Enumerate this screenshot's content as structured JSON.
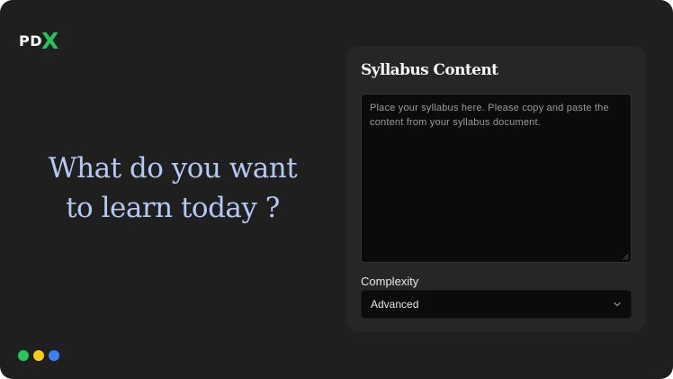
{
  "logo": {
    "prefix": "PD",
    "accent": "X",
    "accent_color": "#22c55e"
  },
  "headline": {
    "line1": "What do you want",
    "line2": "to learn today ?"
  },
  "status_dots": [
    "#22c55e",
    "#facc15",
    "#3b82f6"
  ],
  "card": {
    "title": "Syllabus Content",
    "syllabus_placeholder": "Place your syllabus here. Please copy and paste the content from your syllabus document.",
    "complexity_label": "Complexity",
    "complexity_value": "Advanced"
  }
}
